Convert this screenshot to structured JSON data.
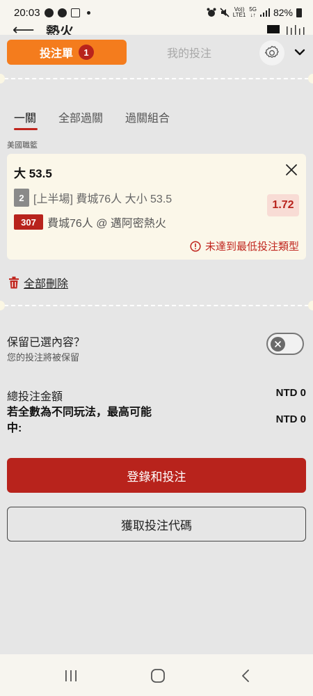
{
  "status_bar": {
    "time": "20:03",
    "net_lines": [
      "Vo))",
      "LTE1"
    ],
    "net_5g": "5G",
    "battery": "82%"
  },
  "underlying_page": {
    "title": "熱火"
  },
  "header": {
    "betslip_label": "投注單",
    "betslip_count": "1",
    "mybets_label": "我的投注"
  },
  "parlay_tabs": [
    {
      "label": "一關",
      "active": true
    },
    {
      "label": "全部過關",
      "active": false
    },
    {
      "label": "過關組合",
      "active": false
    }
  ],
  "league": "美國職籃",
  "selection": {
    "title": "大 53.5",
    "market_number": "2",
    "market_text": "[上半場] 費城76人 大小 53.5",
    "match_number": "307",
    "match_text": "費城76人 @ 邁阿密熱火",
    "odds": "1.72",
    "warning": "未達到最低投注類型"
  },
  "delete_all_label": "全部刪除",
  "keep": {
    "title": "保留已選內容？",
    "subtitle": "您的投注將被保留",
    "enabled": false
  },
  "totals": {
    "stake_label": "總投注金額",
    "stake_value": "NTD 0",
    "max_win_label": "若全數為不同玩法，最高可能中:",
    "max_win_value": "NTD 0"
  },
  "buttons": {
    "login_bet": "登錄和投注",
    "get_code": "獲取投注代碼"
  },
  "colors": {
    "orange": "#f47c1d",
    "red": "#b8231c",
    "card": "#fbf7e9",
    "background": "#e6e6e6"
  }
}
